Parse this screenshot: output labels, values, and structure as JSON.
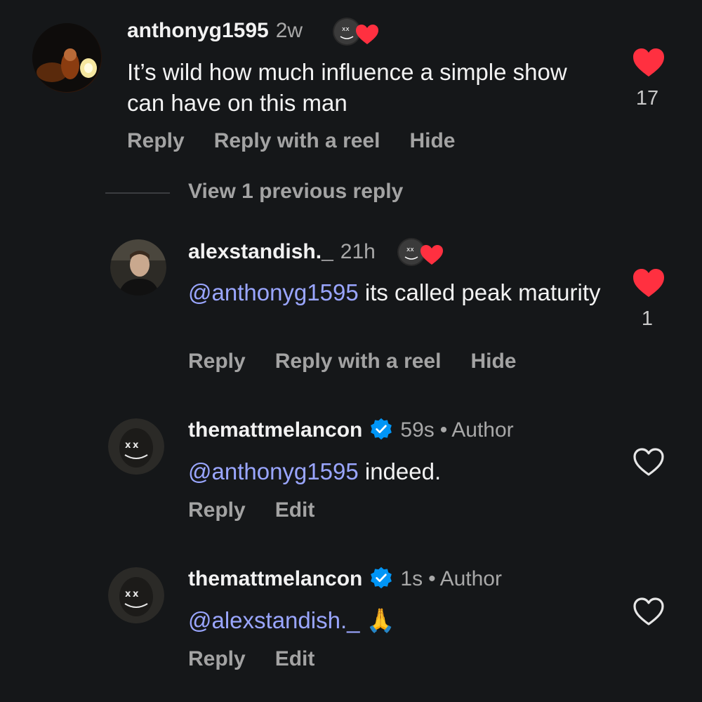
{
  "comments": [
    {
      "username": "anthonyg1595",
      "time": "2w",
      "author_label": "",
      "text": "It’s wild how much influence a simple show can have on this man",
      "mention": "",
      "like_count": "17",
      "liked": true,
      "actions": [
        "Reply",
        "Reply with a reel",
        "Hide"
      ]
    },
    {
      "username": "alexstandish._",
      "time": "21h",
      "author_label": "",
      "mention": "@anthonyg1595",
      "text": " its called peak maturity",
      "like_count": "1",
      "liked": true,
      "actions": [
        "Reply",
        "Reply with a reel",
        "Hide"
      ]
    },
    {
      "username": "themattmelancon",
      "time": "59s",
      "author_label": "Author",
      "mention": "@anthonyg1595",
      "text": " indeed.",
      "like_count": "",
      "liked": false,
      "actions": [
        "Reply",
        "Edit"
      ]
    },
    {
      "username": "themattmelancon",
      "time": "1s",
      "author_label": "Author",
      "mention": "@alexstandish._",
      "text": " 🙏",
      "like_count": "",
      "liked": false,
      "actions": [
        "Reply",
        "Edit"
      ]
    }
  ],
  "view_previous_reply": "View 1 previous reply",
  "separator_dot": "•",
  "colors": {
    "background": "#151719",
    "heart_red": "#ff3040",
    "mention": "#9aa6ff",
    "verified_blue": "#0095f6",
    "secondary_text": "#a8a8a8"
  },
  "icons": {
    "like": "heart-icon",
    "verified": "verified-badge-icon",
    "reaction": "creator-liked-icon"
  }
}
